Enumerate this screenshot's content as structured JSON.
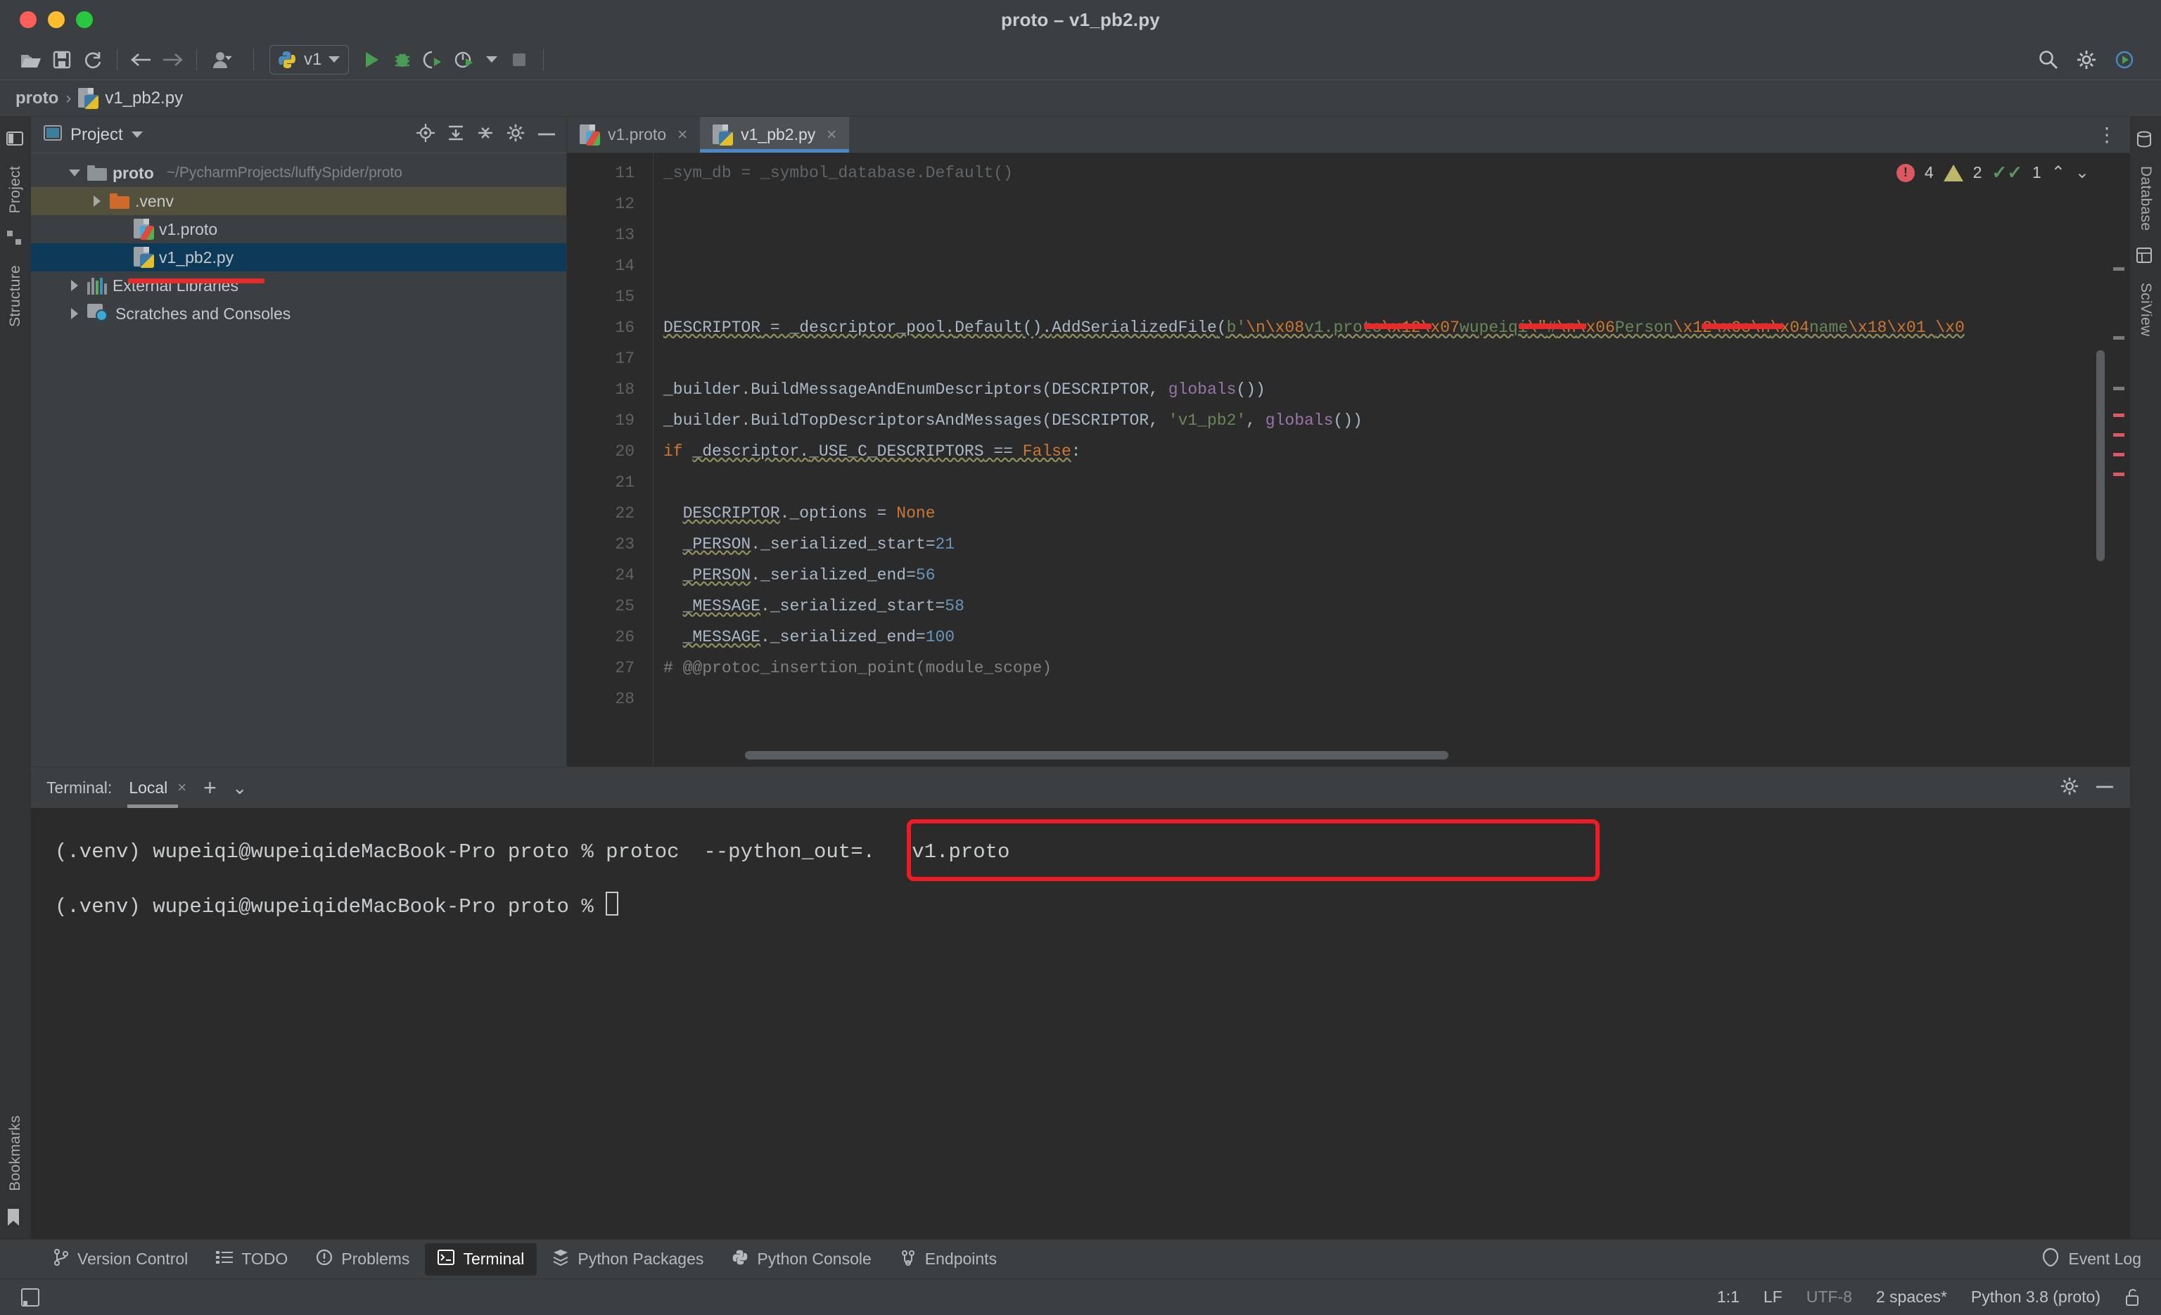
{
  "window": {
    "title": "proto – v1_pb2.py"
  },
  "toolbar": {
    "open_icon": "open-folder-icon",
    "save_icon": "save-icon",
    "sync_icon": "refresh-icon",
    "back_icon": "arrow-left-icon",
    "forward_icon": "arrow-right-icon",
    "account_icon": "user-icon",
    "run_config_label": "v1",
    "run_icon": "run-icon",
    "debug_icon": "debug-icon",
    "coverage_icon": "run-coverage-icon",
    "profile_icon": "profile-icon",
    "stop_icon": "stop-icon",
    "search_icon": "search-icon",
    "settings_icon": "gear-icon",
    "updates_icon": "run-anything-icon"
  },
  "breadcrumb": {
    "project": "proto",
    "separator": "›",
    "file": "v1_pb2.py"
  },
  "left_rail": {
    "items": [
      "Project",
      "Structure"
    ],
    "bottom_item": "Bookmarks"
  },
  "right_rail": {
    "items": [
      "Database",
      "SciView"
    ]
  },
  "project_panel": {
    "title": "Project",
    "header_icons": [
      "locate-icon",
      "expand-all-icon",
      "collapse-all-icon",
      "gear-icon",
      "hide-icon"
    ],
    "tree": [
      {
        "label": "proto",
        "path": "~/PycharmProjects/luffySpider/proto",
        "icon": "folder-icon",
        "twisty": "down",
        "depth": 0,
        "bold": true,
        "selected": "none"
      },
      {
        "label": ".venv",
        "path": "",
        "icon": "folder-orange-icon",
        "twisty": "right",
        "depth": 1,
        "bold": false,
        "selected": "olive"
      },
      {
        "label": "v1.proto",
        "path": "",
        "icon": "proto-file-icon",
        "twisty": "none",
        "depth": 2,
        "bold": false,
        "selected": "none"
      },
      {
        "label": "v1_pb2.py",
        "path": "",
        "icon": "python-file-icon",
        "twisty": "none",
        "depth": 2,
        "bold": false,
        "selected": "blue"
      },
      {
        "label": "External Libraries",
        "path": "",
        "icon": "library-icon",
        "twisty": "right",
        "depth": 0,
        "bold": false,
        "selected": "none"
      },
      {
        "label": "Scratches and Consoles",
        "path": "",
        "icon": "scratches-icon",
        "twisty": "right",
        "depth": 0,
        "bold": false,
        "selected": "none"
      }
    ]
  },
  "editor": {
    "tabs": [
      {
        "label": "v1.proto",
        "icon": "proto-file-icon",
        "active": false
      },
      {
        "label": "v1_pb2.py",
        "icon": "python-file-icon",
        "active": true
      }
    ],
    "close_glyph": "×",
    "kebab": "⋮",
    "inspection": {
      "error_count": "4",
      "warning_count": "2",
      "ok_count": "1",
      "error_glyph": "!",
      "check_glyph": "✓✓",
      "up_glyph": "⌃",
      "down_glyph": "⌄"
    },
    "lines": [
      {
        "no": "11",
        "text": "_sym_db = _symbol_database.Default()",
        "clipped": true
      },
      {
        "no": "12",
        "text": ""
      },
      {
        "no": "13",
        "text": ""
      },
      {
        "no": "14",
        "text": ""
      },
      {
        "no": "15",
        "text": ""
      },
      {
        "no": "16",
        "text": "DESCRIPTOR = _descriptor_pool.Default().AddSerializedFile(b'\\n\\x08v1.proto\\x12\\x07wupeiqi\\\"#\\n\\x06Person\\x12\\x0c\\n\\x04name\\x18\\x01 \\x0"
      },
      {
        "no": "17",
        "text": ""
      },
      {
        "no": "18",
        "text": "_builder.BuildMessageAndEnumDescriptors(DESCRIPTOR, globals())"
      },
      {
        "no": "19",
        "text": "_builder.BuildTopDescriptorsAndMessages(DESCRIPTOR, 'v1_pb2', globals())"
      },
      {
        "no": "20",
        "text": "if _descriptor._USE_C_DESCRIPTORS == False:"
      },
      {
        "no": "21",
        "text": ""
      },
      {
        "no": "22",
        "text": "  DESCRIPTOR._options = None"
      },
      {
        "no": "23",
        "text": "  _PERSON._serialized_start=21"
      },
      {
        "no": "24",
        "text": "  _PERSON._serialized_end=56"
      },
      {
        "no": "25",
        "text": "  _MESSAGE._serialized_start=58"
      },
      {
        "no": "26",
        "text": "  _MESSAGE._serialized_end=100"
      },
      {
        "no": "27",
        "text": "# @@protoc_insertion_point(module_scope)"
      },
      {
        "no": "28",
        "text": ""
      }
    ]
  },
  "terminal": {
    "label": "Terminal:",
    "tab": "Local",
    "tab_close": "×",
    "add_glyph": "+",
    "chevron_glyph": "⌄",
    "settings_icon": "gear-icon",
    "minimize_icon": "minimize-icon",
    "lines": [
      {
        "prompt": "(.venv) wupeiqi@wupeiqideMacBook-Pro proto % ",
        "command": "protoc  --python_out=.   v1.proto",
        "highlighted": true
      },
      {
        "prompt": "(.venv) wupeiqi@wupeiqideMacBook-Pro proto % ",
        "command": "",
        "highlighted": false
      }
    ]
  },
  "toolwindow_bar": {
    "items": [
      {
        "label": "Version Control",
        "icon": "branch-icon",
        "active": false
      },
      {
        "label": "TODO",
        "icon": "list-icon",
        "active": false
      },
      {
        "label": "Problems",
        "icon": "problems-icon",
        "active": false
      },
      {
        "label": "Terminal",
        "icon": "terminal-icon",
        "active": true
      },
      {
        "label": "Python Packages",
        "icon": "packages-icon",
        "active": false
      },
      {
        "label": "Python Console",
        "icon": "python-icon",
        "active": false
      },
      {
        "label": "Endpoints",
        "icon": "endpoints-icon",
        "active": false
      }
    ],
    "event_log": "Event Log",
    "event_log_icon": "balloon-icon"
  },
  "statusbar": {
    "left_icon": "layout-icon",
    "position": "1:1",
    "line_sep": "LF",
    "encoding": "UTF-8",
    "indent": "2 spaces*",
    "interpreter": "Python 3.8 (proto)",
    "lock_icon": "unlock-icon"
  },
  "colors": {
    "accent_blue": "#4a88c7",
    "error_red": "#ed1c24",
    "selection_blue": "#0d3a58",
    "selection_olive": "#53503c",
    "panel_bg": "#3c3f41",
    "editor_bg": "#2b2b2b"
  }
}
